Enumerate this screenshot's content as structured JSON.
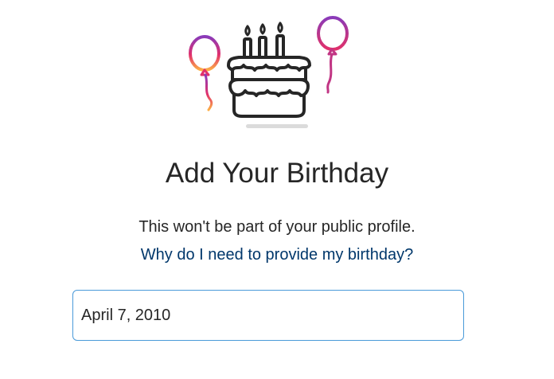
{
  "heading": {
    "title": "Add Your Birthday"
  },
  "info": {
    "subtitle": "This won't be part of your public profile.",
    "help_link": "Why do I need to provide my birthday?"
  },
  "birthday_input": {
    "value": "April 7, 2010"
  },
  "illustration": {
    "icon": "birthday-cake-icon",
    "balloons": [
      "balloon-icon",
      "balloon-icon"
    ],
    "colors": {
      "outline": "#262626",
      "gradient_start": "#8a3ab9",
      "gradient_mid": "#e1306c",
      "gradient_end": "#fcaf45",
      "shadow": "#dbdbdb"
    }
  },
  "colors": {
    "link": "#00376b",
    "focus_border": "#4a9ad9",
    "text": "#262626"
  }
}
